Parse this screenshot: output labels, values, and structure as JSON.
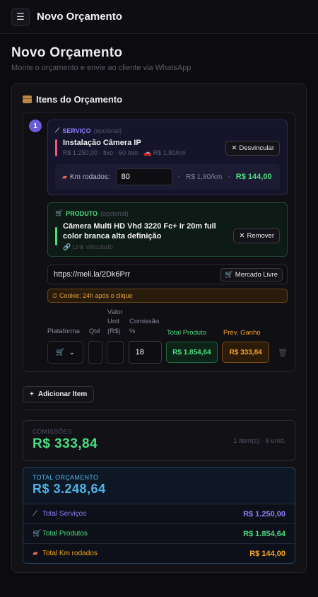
{
  "topbar": {
    "menu_icon": "☰",
    "title": "Novo Orçamento"
  },
  "header": {
    "title": "Novo Orçamento",
    "subtitle": "Monte o orçamento e envie ao cliente via WhatsApp"
  },
  "items_section": {
    "title": "Itens do Orçamento",
    "item": {
      "number": "1",
      "service": {
        "tag": "SERVIÇO",
        "optional": "(opcional)",
        "name": "Instalação Câmera IP",
        "meta": "R$ 1.250,00 · fixo · 60 min · 🚗 R$ 1,80/km",
        "unlink_label": "Desvincular",
        "km_label": "Km rodados:",
        "km_value": "80",
        "km_rate": "R$ 1,80/km",
        "km_total": "R$ 144,00"
      },
      "product": {
        "tag": "PRODUTO",
        "optional": "(opcional)",
        "name": "Câmera Multi HD Vhd 3220 Fc+ Ir 20m full color branca alta definição",
        "link_note": "Link vinculado",
        "remove_label": "Remover"
      },
      "url": "https://meli.la/2Dk6Prr",
      "marketplace_label": "Mercado Livre",
      "cookie_note": "Cookie: 24h após o clique",
      "fields": {
        "platform_label": "Plataforma",
        "qty_label": "Qtd",
        "unit_label_lines": [
          "Valor",
          "Unit",
          "(R$)"
        ],
        "commission_label_lines": [
          "Comissão",
          "%"
        ],
        "total_label": "Total Produto",
        "prev_label": "Prev. Ganho",
        "commission_value": "18",
        "total_value": "R$ 1.854,64",
        "prev_value": "R$ 333,84"
      }
    },
    "add_item_label": "Adicionar Item"
  },
  "commissions": {
    "label": "COMISSÕES",
    "value": "R$ 333,84",
    "meta": "1 item(s) · 8 unid."
  },
  "total": {
    "label": "TOTAL ORÇAMENTO",
    "value": "R$ 3.248,64",
    "rows": [
      {
        "label": "Total Serviços",
        "value": "R$ 1.250,00"
      },
      {
        "label": "Total Produtos",
        "value": "R$ 1.854,64"
      },
      {
        "label": "Total Km rodados",
        "value": "R$ 144,00"
      }
    ]
  },
  "colors": {
    "service": "#8b7ff7",
    "product": "#4ade80",
    "km": "#f5a623",
    "total": "#4fb3e8"
  }
}
